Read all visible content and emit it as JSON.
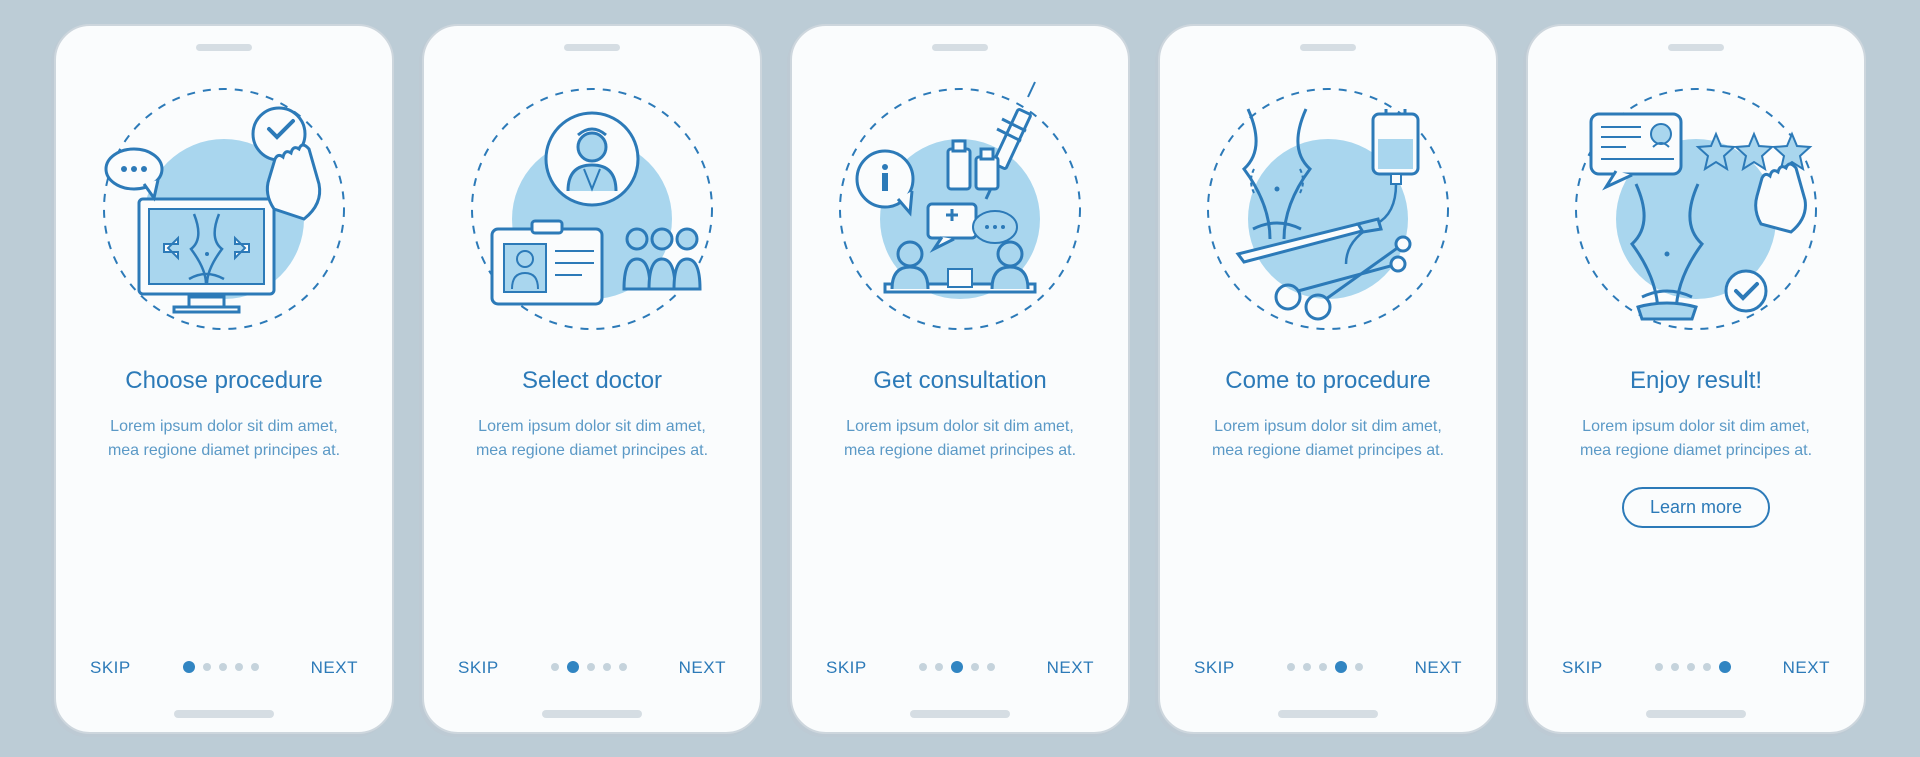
{
  "colors": {
    "stroke": "#2c7ab8",
    "fill": "#a9d6ee",
    "accent": "#3c8cc4"
  },
  "skip_label": "SKIP",
  "next_label": "NEXT",
  "learn_more_label": "Learn more",
  "screens": [
    {
      "title": "Choose procedure",
      "desc": "Lorem ipsum dolor sit dim amet, mea regione diamet principes at."
    },
    {
      "title": "Select doctor",
      "desc": "Lorem ipsum dolor sit dim amet, mea regione diamet principes at."
    },
    {
      "title": "Get consultation",
      "desc": "Lorem ipsum dolor sit dim amet, mea regione diamet principes at."
    },
    {
      "title": "Come to procedure",
      "desc": "Lorem ipsum dolor sit dim amet, mea regione diamet principes at."
    },
    {
      "title": "Enjoy result!",
      "desc": "Lorem ipsum dolor sit dim amet, mea regione diamet principes at."
    }
  ]
}
